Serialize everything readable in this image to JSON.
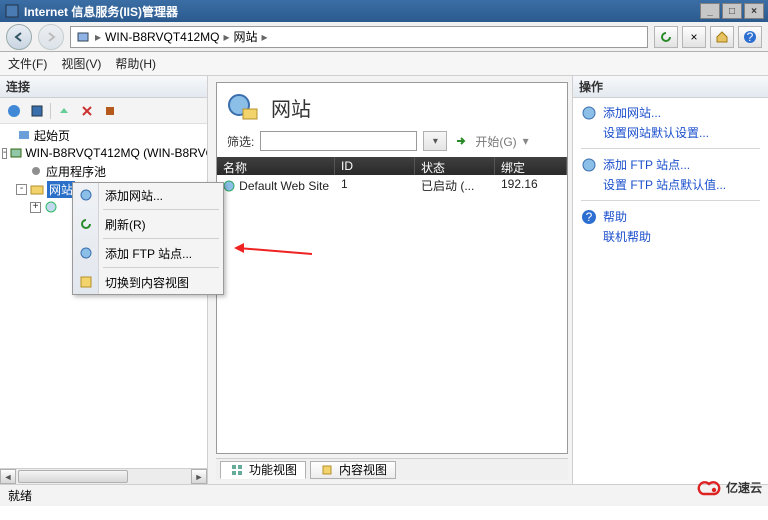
{
  "window": {
    "title": "Internet 信息服务(IIS)管理器"
  },
  "breadcrumb": {
    "server": "WIN-B8RVQT412MQ",
    "node": "网站"
  },
  "menu": {
    "file": "文件(F)",
    "view": "视图(V)",
    "help": "帮助(H)"
  },
  "panels": {
    "connections": "连接",
    "actions": "操作"
  },
  "tree": {
    "start_page": "起始页",
    "server": "WIN-B8RVQT412MQ (WIN-B8RVQT",
    "app_pools": "应用程序池",
    "sites": "网站"
  },
  "page": {
    "title": "网站",
    "filter_label": "筛选:",
    "go": "开始(G)",
    "columns": {
      "name": "名称",
      "id": "ID",
      "status": "状态",
      "binding": "绑定"
    },
    "rows": [
      {
        "name": "Default Web Site",
        "id": "1",
        "status": "已启动 (...",
        "binding": "192.16"
      }
    ]
  },
  "tabs": {
    "features": "功能视图",
    "content": "内容视图"
  },
  "actions": {
    "add_site": "添加网站...",
    "set_site_defaults": "设置网站默认设置...",
    "add_ftp": "添加 FTP 站点...",
    "set_ftp_defaults": "设置 FTP 站点默认值...",
    "help": "帮助",
    "online_help": "联机帮助"
  },
  "context": {
    "add_site": "添加网站...",
    "refresh": "刷新(R)",
    "add_ftp": "添加 FTP 站点...",
    "switch_content": "切换到内容视图"
  },
  "status": {
    "ready": "就绪"
  },
  "watermark": {
    "text": "亿速云"
  }
}
